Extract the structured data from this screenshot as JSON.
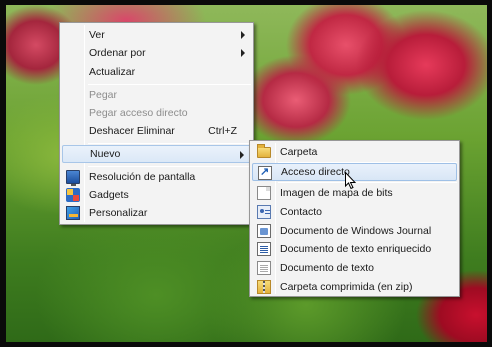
{
  "context_menu": {
    "items": [
      {
        "label": "Ver",
        "submenu": true
      },
      {
        "label": "Ordenar por",
        "submenu": true
      },
      {
        "label": "Actualizar"
      },
      {
        "label": "Pegar",
        "disabled": true
      },
      {
        "label": "Pegar acceso directo",
        "disabled": true
      },
      {
        "label": "Deshacer Eliminar",
        "shortcut": "Ctrl+Z"
      },
      {
        "label": "Nuevo",
        "submenu": true,
        "highlighted": true
      },
      {
        "label": "Resolución de pantalla",
        "icon": "monitor-icon"
      },
      {
        "label": "Gadgets",
        "icon": "gadgets-icon"
      },
      {
        "label": "Personalizar",
        "icon": "personalize-icon"
      }
    ]
  },
  "new_submenu": {
    "items": [
      {
        "label": "Carpeta",
        "icon": "folder-icon"
      },
      {
        "label": "Acceso directo",
        "icon": "shortcut-icon",
        "hovered": true
      },
      {
        "label": "Imagen de mapa de bits",
        "icon": "bitmap-icon"
      },
      {
        "label": "Contacto",
        "icon": "contact-icon"
      },
      {
        "label": "Documento de Windows Journal",
        "icon": "journal-icon"
      },
      {
        "label": "Documento de texto enriquecido",
        "icon": "rich-text-icon"
      },
      {
        "label": "Documento de texto",
        "icon": "text-document-icon"
      },
      {
        "label": "Carpeta comprimida (en zip)",
        "icon": "zip-folder-icon"
      }
    ]
  },
  "colors": {
    "menu_background": "#f3f3f3",
    "menu_border": "#979797",
    "highlight_border": "#a8c6e8",
    "disabled_text": "#8d8d8d"
  }
}
